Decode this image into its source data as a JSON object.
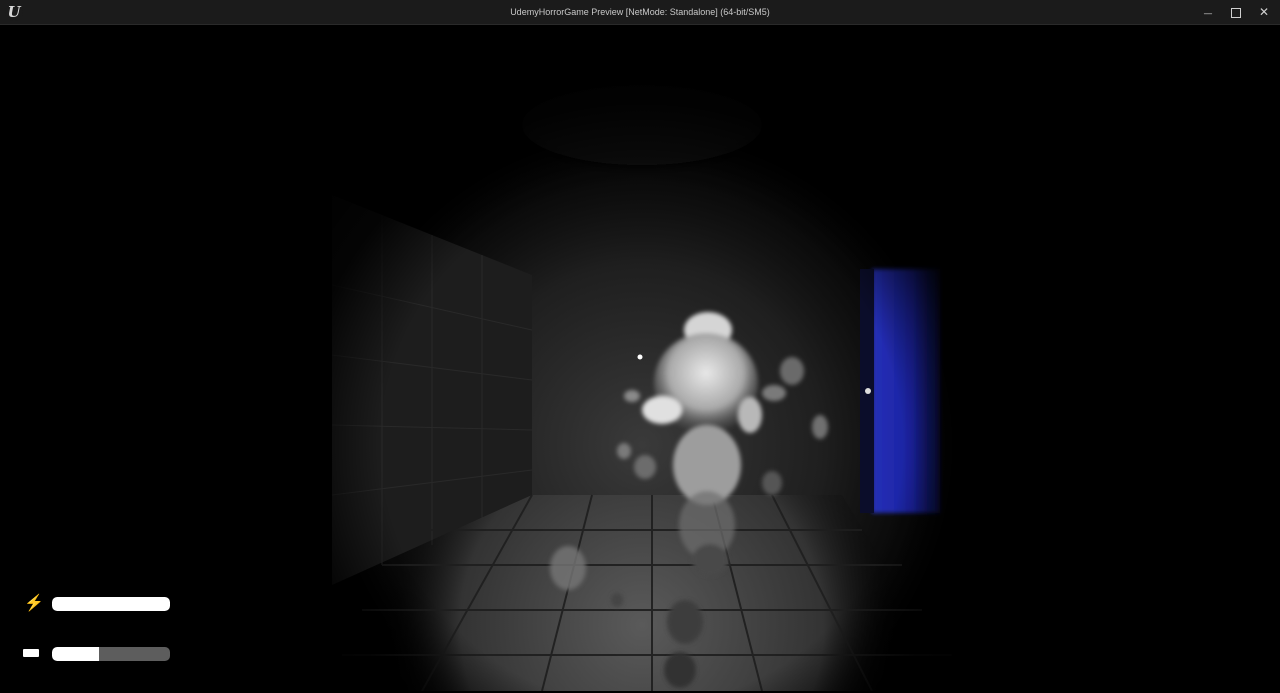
{
  "window": {
    "title": "UdemyHorrorGame Preview [NetMode: Standalone]  (64-bit/SM5)",
    "app_icon": "unreal-engine-logo",
    "logo_letter": "U",
    "minimize_glyph": "—",
    "close_glyph": "✕"
  },
  "hud": {
    "stamina": {
      "icon": "lightning-bolt-icon",
      "glyph": "⚡",
      "value": 1.0
    },
    "flashlight": {
      "icon": "battery-icon",
      "value": 0.4
    }
  },
  "colors": {
    "door": "#1a22a0",
    "bar_fill": "#ffffff",
    "bar_track": "#5d5d5d",
    "titlebar": "#1b1b1b"
  }
}
